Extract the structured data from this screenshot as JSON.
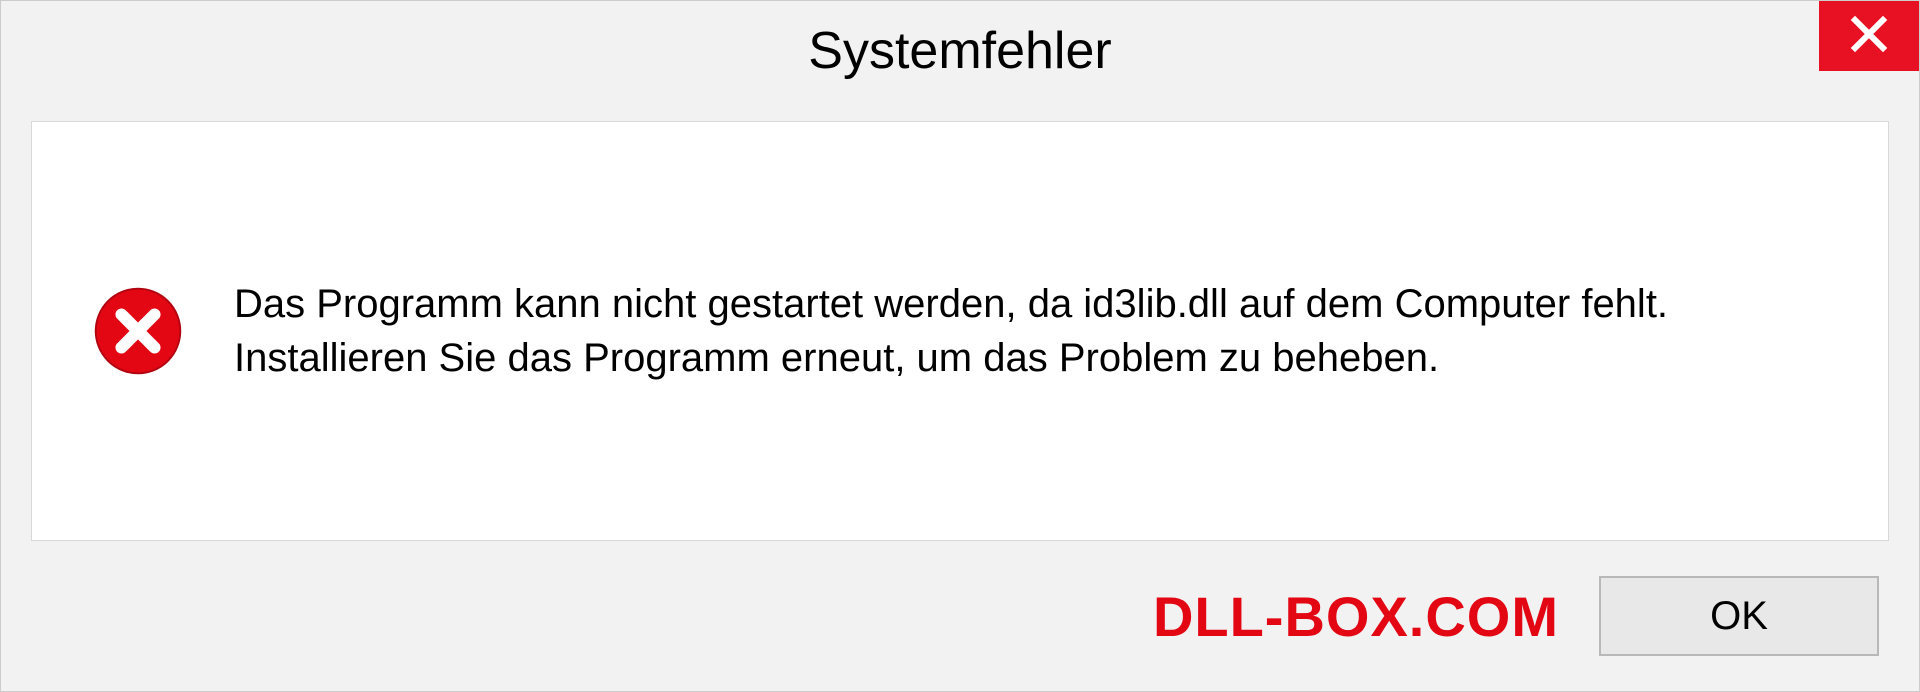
{
  "dialog": {
    "title": "Systemfehler",
    "message": "Das Programm kann nicht gestartet werden, da id3lib.dll auf dem Computer fehlt. Installieren Sie das Programm erneut, um das Problem zu beheben.",
    "ok_label": "OK"
  },
  "watermark": "DLL-BOX.COM",
  "colors": {
    "close_red": "#e81123",
    "error_red": "#e30613",
    "watermark_red": "#e30613"
  }
}
